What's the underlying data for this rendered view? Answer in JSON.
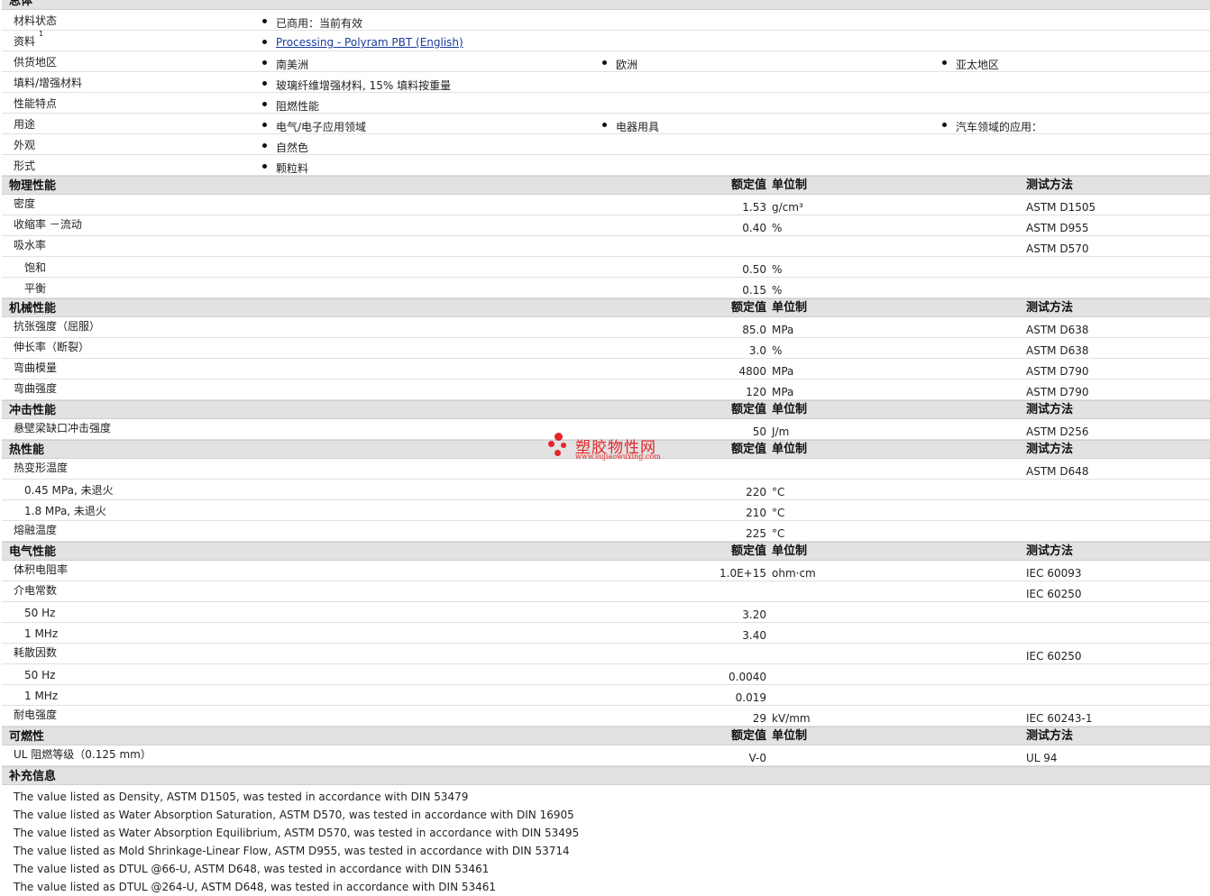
{
  "general": {
    "title": "总体",
    "rows": [
      {
        "label": "材料状态",
        "items": [
          "已商用：当前有效"
        ]
      },
      {
        "label": "资料",
        "sup": "1",
        "items": [
          "Processing - Polyram PBT (English)"
        ],
        "link": true
      },
      {
        "label": "供货地区",
        "items": [
          "南美洲",
          "欧洲",
          "亚太地区"
        ]
      },
      {
        "label": "填料/增强材料",
        "items": [
          "玻璃纤维增强材料, 15% 填料按重量"
        ]
      },
      {
        "label": "性能特点",
        "items": [
          "阻燃性能"
        ]
      },
      {
        "label": "用途",
        "items": [
          "电气/电子应用领域",
          "电器用具",
          "汽车领域的应用："
        ]
      },
      {
        "label": "外观",
        "items": [
          "自然色"
        ]
      },
      {
        "label": "形式",
        "items": [
          "颗粒料"
        ]
      }
    ]
  },
  "column_headers": {
    "value": "额定值",
    "unit": "单位制",
    "method": "测试方法"
  },
  "sections": [
    {
      "title": "物理性能",
      "rows": [
        {
          "name": "密度",
          "value": "1.53",
          "unit": "g/cm³",
          "method": "ASTM D1505"
        },
        {
          "name": "收缩率 －流动",
          "value": "0.40",
          "unit": "%",
          "method": "ASTM D955"
        },
        {
          "name": "吸水率",
          "value": "",
          "unit": "",
          "method": "ASTM D570"
        },
        {
          "name": "饱和",
          "value": "0.50",
          "unit": "%",
          "method": "",
          "sub": true
        },
        {
          "name": "平衡",
          "value": "0.15",
          "unit": "%",
          "method": "",
          "sub": true
        }
      ]
    },
    {
      "title": "机械性能",
      "rows": [
        {
          "name": "抗张强度（屈服）",
          "value": "85.0",
          "unit": "MPa",
          "method": "ASTM D638"
        },
        {
          "name": "伸长率（断裂）",
          "value": "3.0",
          "unit": "%",
          "method": "ASTM D638"
        },
        {
          "name": "弯曲模量",
          "value": "4800",
          "unit": "MPa",
          "method": "ASTM D790"
        },
        {
          "name": "弯曲强度",
          "value": "120",
          "unit": "MPa",
          "method": "ASTM D790"
        }
      ]
    },
    {
      "title": "冲击性能",
      "rows": [
        {
          "name": "悬壁梁缺口冲击强度",
          "value": "50",
          "unit": "J/m",
          "method": "ASTM D256"
        }
      ]
    },
    {
      "title": "热性能",
      "rows": [
        {
          "name": "热变形温度",
          "value": "",
          "unit": "",
          "method": "ASTM D648"
        },
        {
          "name": "0.45 MPa, 未退火",
          "value": "220",
          "unit": "°C",
          "method": "",
          "sub": true
        },
        {
          "name": "1.8 MPa, 未退火",
          "value": "210",
          "unit": "°C",
          "method": "",
          "sub": true
        },
        {
          "name": "熔融温度",
          "value": "225",
          "unit": "°C",
          "method": ""
        }
      ]
    },
    {
      "title": "电气性能",
      "rows": [
        {
          "name": "体积电阻率",
          "value": "1.0E+15",
          "unit": "ohm·cm",
          "method": "IEC 60093"
        },
        {
          "name": "介电常数",
          "value": "",
          "unit": "",
          "method": "IEC 60250"
        },
        {
          "name": "50 Hz",
          "value": "3.20",
          "unit": "",
          "method": "",
          "sub": true
        },
        {
          "name": "1 MHz",
          "value": "3.40",
          "unit": "",
          "method": "",
          "sub": true
        },
        {
          "name": "耗散因数",
          "value": "",
          "unit": "",
          "method": "IEC 60250"
        },
        {
          "name": "50 Hz",
          "value": "0.0040",
          "unit": "",
          "method": "",
          "sub": true
        },
        {
          "name": "1 MHz",
          "value": "0.019",
          "unit": "",
          "method": "",
          "sub": true
        },
        {
          "name": "耐电强度",
          "value": "29",
          "unit": "kV/mm",
          "method": "IEC 60243-1"
        }
      ]
    },
    {
      "title": "可燃性",
      "rows": [
        {
          "name": "UL 阻燃等级（0.125 mm）",
          "value": "V-0",
          "unit": "",
          "method": "UL 94"
        }
      ]
    }
  ],
  "supplementary": {
    "title": "补充信息",
    "notes": [
      "The value listed as Density, ASTM D1505, was tested in accordance with DIN 53479",
      "The value listed as Water Absorption Saturation, ASTM D570, was tested in accordance with DIN 16905",
      "The value listed as Water Absorption Equilibrium, ASTM D570, was tested in accordance with DIN 53495",
      "The value listed as Mold Shrinkage-Linear Flow, ASTM D955, was tested in accordance with DIN 53714",
      "The value listed as DTUL @66-U, ASTM D648, was tested in accordance with DIN 53461",
      "The value listed as DTUL @264-U, ASTM D648, was tested in accordance with DIN 53461"
    ]
  },
  "watermark": {
    "title": "塑胶物性网",
    "url": "www.sujiaowuxing.com"
  },
  "colors": {
    "header_bg": "#e2e2e2",
    "link": "#1a3c9c",
    "watermark": "#e3262a"
  }
}
